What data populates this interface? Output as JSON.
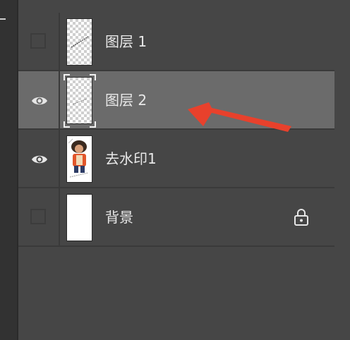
{
  "layers_panel": {
    "layers": [
      {
        "name": "图层 1",
        "visible": false,
        "selected": false,
        "thumb": "transparent-text"
      },
      {
        "name": "图层 2",
        "visible": true,
        "selected": true,
        "thumb": "transparent-text"
      },
      {
        "name": "去水印1",
        "visible": true,
        "selected": false,
        "thumb": "image"
      },
      {
        "name": "背景",
        "visible": false,
        "selected": false,
        "thumb": "white",
        "locked": true
      }
    ]
  },
  "icons": {
    "visibility": "eye-icon",
    "lock": "lock-icon"
  },
  "colors": {
    "panel_bg": "#464646",
    "selected_row_bg": "#6b6b6b",
    "annotation_arrow": "#e8412c",
    "text": "#e8e8e8"
  }
}
